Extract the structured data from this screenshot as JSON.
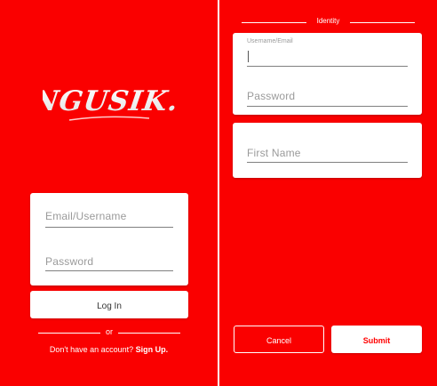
{
  "colors": {
    "brand_red": "#fa0000",
    "white": "#ffffff"
  },
  "login": {
    "logo_text": "NGUSIK.",
    "email_placeholder": "Email/Username",
    "password_placeholder": "Password",
    "login_button": "Log In",
    "or_text": "or",
    "no_account_text": "Don't have an account?",
    "signup_link": "Sign Up."
  },
  "signup": {
    "section_title": "Identity",
    "username_label": "Username/Email",
    "username_value": "",
    "password_placeholder": "Password",
    "first_name_placeholder": "First Name",
    "cancel_button": "Cancel",
    "submit_button": "Submit"
  }
}
